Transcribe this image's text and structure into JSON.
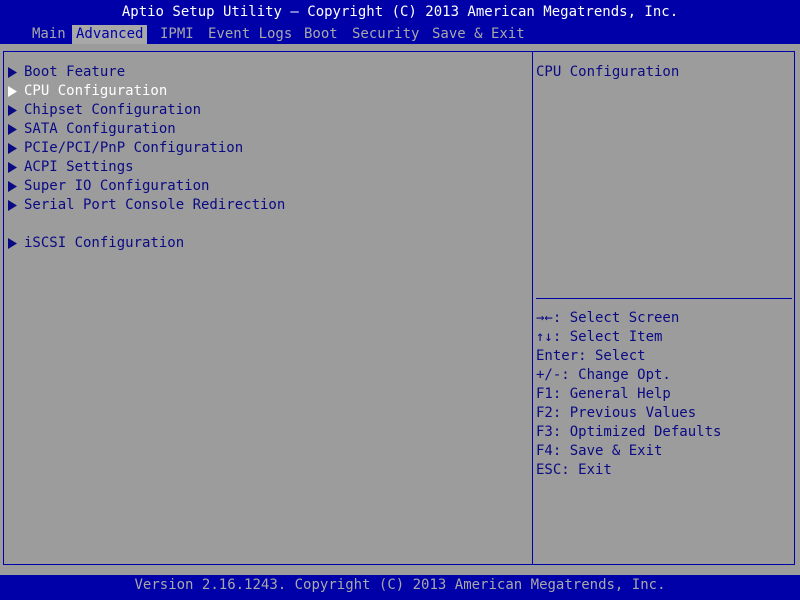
{
  "header": {
    "title": "Aptio Setup Utility – Copyright (C) 2013 American Megatrends, Inc."
  },
  "tabs": [
    {
      "label": "Main",
      "active": false
    },
    {
      "label": "Advanced",
      "active": true
    },
    {
      "label": "IPMI",
      "active": false
    },
    {
      "label": "Event Logs",
      "active": false
    },
    {
      "label": "Boot",
      "active": false
    },
    {
      "label": "Security",
      "active": false
    },
    {
      "label": "Save & Exit",
      "active": false
    }
  ],
  "menu": {
    "selected_index": 1,
    "items": [
      {
        "label": "Boot Feature",
        "icon": "right-triangle-icon"
      },
      {
        "label": "CPU Configuration",
        "icon": "right-triangle-icon"
      },
      {
        "label": "Chipset Configuration",
        "icon": "right-triangle-icon"
      },
      {
        "label": "SATA Configuration",
        "icon": "right-triangle-icon"
      },
      {
        "label": "PCIe/PCI/PnP Configuration",
        "icon": "right-triangle-icon"
      },
      {
        "label": "ACPI Settings",
        "icon": "right-triangle-icon"
      },
      {
        "label": "Super IO Configuration",
        "icon": "right-triangle-icon"
      },
      {
        "label": "Serial Port Console Redirection",
        "icon": "right-triangle-icon"
      },
      {
        "label": "iSCSI Configuration",
        "icon": "right-triangle-icon"
      }
    ]
  },
  "help": {
    "description": "CPU Configuration",
    "keys": [
      "→←: Select Screen",
      "↑↓: Select Item",
      "Enter: Select",
      "+/-: Change Opt.",
      "F1: General Help",
      "F2: Previous Values",
      "F3: Optimized Defaults",
      "F4: Save & Exit",
      "ESC: Exit"
    ]
  },
  "footer": {
    "text": "Version 2.16.1243. Copyright (C) 2013 American Megatrends, Inc."
  },
  "colors": {
    "bar_blue": "#0000a8",
    "panel_gray": "#9c9c9c",
    "text_blue": "#0a0a84",
    "highlight_white": "#ffffff"
  }
}
